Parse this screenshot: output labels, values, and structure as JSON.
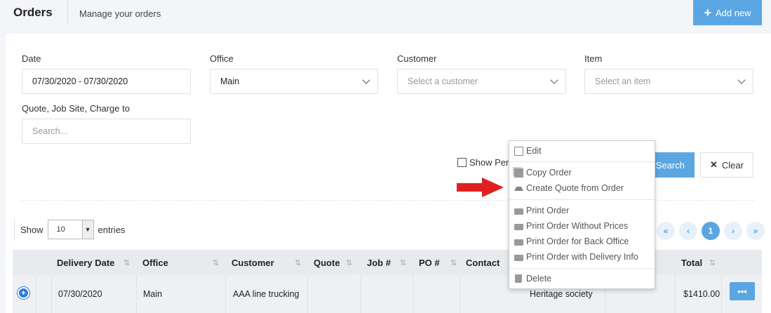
{
  "header": {
    "title": "Orders",
    "subtitle": "Manage your orders",
    "add_button": "Add new"
  },
  "filters": {
    "date_label": "Date",
    "date_value": "07/30/2020 - 07/30/2020",
    "office_label": "Office",
    "office_value": "Main",
    "customer_label": "Customer",
    "customer_placeholder": "Select a customer",
    "item_label": "Item",
    "item_placeholder": "Select an item",
    "quote_label": "Quote, Job Site, Charge to",
    "quote_placeholder": "Search...",
    "show_pending": "Show Pen",
    "search_button": "Search",
    "clear_button": "Clear"
  },
  "table_controls": {
    "show": "Show",
    "entries_value": "10",
    "entries": "entries",
    "page": "1"
  },
  "columns": [
    "Delivery Date",
    "Office",
    "Customer",
    "Quote",
    "Job #",
    "PO #",
    "Contact",
    "Total"
  ],
  "rows": [
    {
      "delivery_date": "07/30/2020",
      "office": "Main",
      "customer": "AAA line trucking",
      "job_site": "Heritage society",
      "total": "$1410.00"
    }
  ],
  "context_menu": {
    "edit": "Edit",
    "copy_order": "Copy Order",
    "create_quote": "Create Quote from Order",
    "print_order": "Print Order",
    "print_without_prices": "Print Order Without Prices",
    "print_back_office": "Print Order for Back Office",
    "print_delivery_info": "Print Order with Delivery Info",
    "delete": "Delete"
  },
  "colors": {
    "accent": "#5aa6e3",
    "arrow": "#e02020"
  }
}
